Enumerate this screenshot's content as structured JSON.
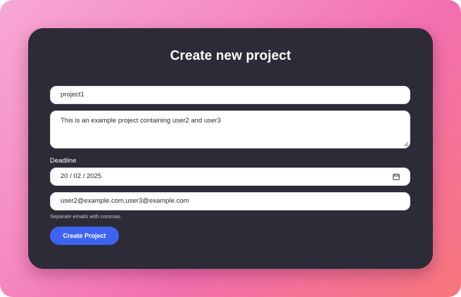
{
  "form": {
    "title": "Create new project",
    "project_name_value": "project1",
    "description_value": "This is an example project containing user2 and user3",
    "deadline_label": "Deadline",
    "deadline_value": "20 / 02 / 2025",
    "emails_value": "user2@example.com,user3@example.com",
    "emails_hint": "Separate emails with commas.",
    "submit_label": "Create Project"
  },
  "colors": {
    "card_background": "#2c2b37",
    "button": "#3e63f0",
    "gradient_start": "#f7a8d4",
    "gradient_end": "#f7767a"
  },
  "icons": {
    "date_picker": "calendar-icon"
  }
}
